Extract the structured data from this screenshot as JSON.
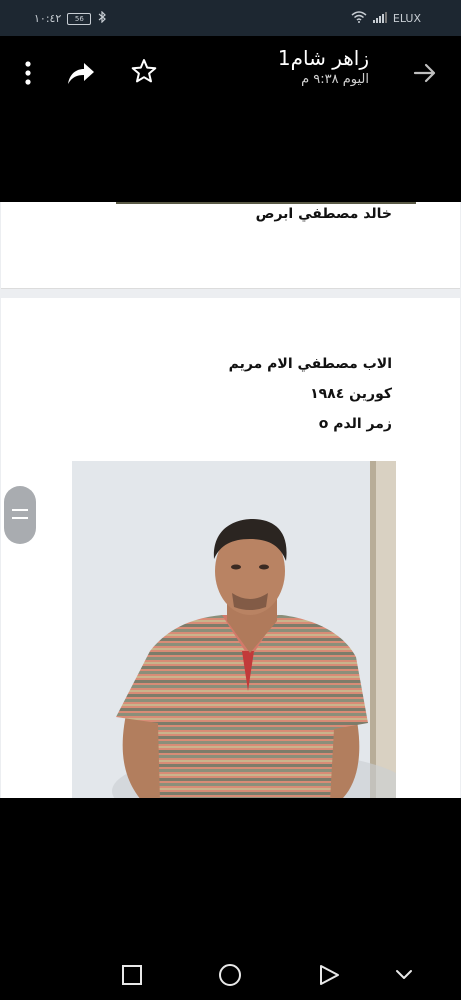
{
  "status_bar": {
    "time": "١٠:٤٢",
    "battery": "56",
    "carrier": "ELUX"
  },
  "header": {
    "title": "زاهر شام1",
    "subtitle": "اليوم ٩:٣٨ م",
    "icons": [
      "more-vert-icon",
      "share-icon",
      "star-icon",
      "forward-arrow-icon"
    ]
  },
  "document": {
    "page1_line": "خالد مصطفي ابرص",
    "page2_lines": [
      "الاب مصطفي الام مريم",
      "كورين ١٩٨٤",
      "زمر الدم o"
    ]
  },
  "nav_icons": [
    "square-icon",
    "circle-icon",
    "triangle-back-icon",
    "chevron-down-icon"
  ]
}
